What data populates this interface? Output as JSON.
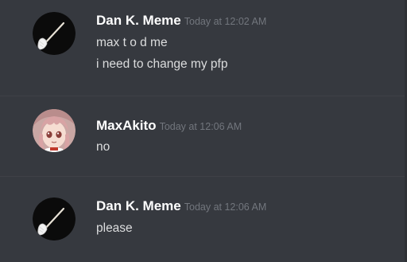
{
  "messages": [
    {
      "author": "Dan K. Meme",
      "timestamp": "Today at 12:02 AM",
      "avatar_icon": "broom-avatar-icon",
      "lines": [
        "max t o d me",
        "i need to change my pfp"
      ]
    },
    {
      "author": "MaxAkito",
      "timestamp": "Today at 12:06 AM",
      "avatar_icon": "anime-girl-avatar-icon",
      "lines": [
        "no"
      ]
    },
    {
      "author": "Dan K. Meme",
      "timestamp": "Today at 12:06 AM",
      "avatar_icon": "broom-avatar-icon",
      "lines": [
        "please"
      ]
    }
  ],
  "colors": {
    "background": "#36393f",
    "username": "#ffffff",
    "timestamp": "#72767d",
    "text": "#dcddde"
  }
}
